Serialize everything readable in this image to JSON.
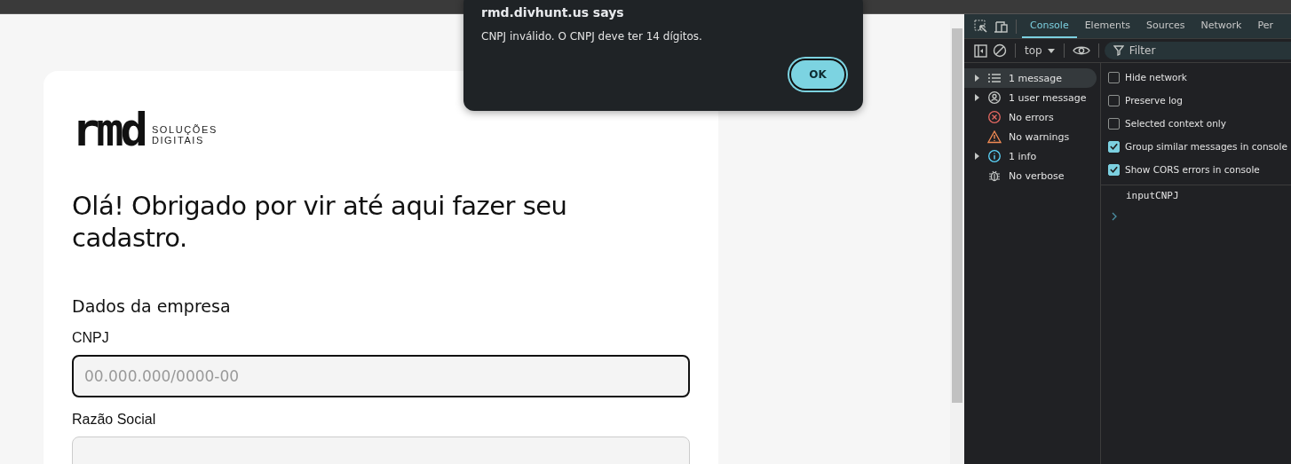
{
  "page": {
    "logo": {
      "wordmark": "rmd",
      "tagline": [
        "SOLUÇÕES",
        "DIGITAIS"
      ]
    },
    "heading": "Olá! Obrigado por vir até aqui fazer seu cadastro.",
    "section_title": "Dados da empresa",
    "fields": [
      {
        "label": "CNPJ",
        "placeholder": "00.000.000/0000-00",
        "focused": true
      },
      {
        "label": "Razão Social",
        "focused": false
      }
    ]
  },
  "dialog": {
    "title": "rmd.divhunt.us says",
    "message": "CNPJ inválido. O CNPJ deve ter 14 dígitos.",
    "buttons": [
      "OK"
    ]
  },
  "devtools": {
    "tabs": [
      {
        "label": "Console",
        "selected": true
      },
      {
        "label": "Elements",
        "selected": false
      },
      {
        "label": "Sources",
        "selected": false
      },
      {
        "label": "Network",
        "selected": false
      },
      {
        "label": "Per",
        "selected": false
      }
    ],
    "context": "top",
    "filter_placeholder": "Filter",
    "sidebar": [
      {
        "kind": "list",
        "label": "1 message",
        "expandable": true,
        "selected": true
      },
      {
        "kind": "user",
        "label": "1 user message",
        "expandable": true,
        "selected": false
      },
      {
        "kind": "error",
        "label": "No errors",
        "expandable": false,
        "selected": false
      },
      {
        "kind": "warning",
        "label": "No warnings",
        "expandable": false,
        "selected": false
      },
      {
        "kind": "info",
        "label": "1 info",
        "expandable": true,
        "selected": false
      },
      {
        "kind": "bug",
        "label": "No verbose",
        "expandable": false,
        "selected": false
      }
    ],
    "settings": [
      {
        "label": "Hide network",
        "checked": false
      },
      {
        "label": "Preserve log",
        "checked": false
      },
      {
        "label": "Selected context only",
        "checked": false
      },
      {
        "label": "Group similar messages in console",
        "checked": true
      },
      {
        "label": "Show CORS errors in console",
        "checked": true
      }
    ],
    "console_lines": [
      "inputCNPJ"
    ]
  }
}
